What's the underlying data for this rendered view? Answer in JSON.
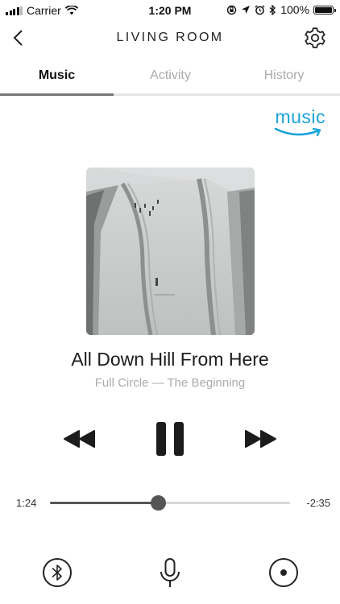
{
  "status_bar": {
    "carrier": "Carrier",
    "time": "1:20 PM",
    "battery": "100%"
  },
  "header": {
    "title": "LIVING ROOM"
  },
  "tabs": [
    {
      "label": "Music",
      "active": true
    },
    {
      "label": "Activity",
      "active": false
    },
    {
      "label": "History",
      "active": false
    }
  ],
  "service": {
    "label": "music",
    "color": "#1aa3d9"
  },
  "now_playing": {
    "title": "All Down Hill From Here",
    "subtitle": "Full Circle — The Beginning"
  },
  "playback": {
    "elapsed": "1:24",
    "remaining": "-2:35",
    "progress_fraction": 0.45
  },
  "icons": [
    "back-chevron-icon",
    "gear-icon",
    "rewind-icon",
    "pause-icon",
    "fast-forward-icon",
    "bluetooth-icon",
    "microphone-icon",
    "record-icon"
  ]
}
